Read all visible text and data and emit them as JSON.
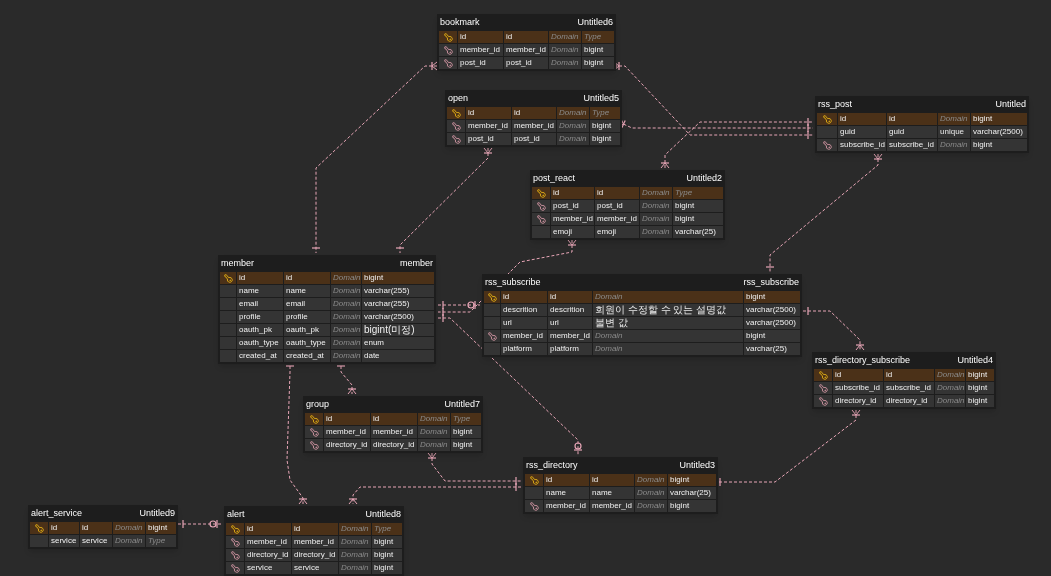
{
  "tables": [
    {
      "name": "bookmark",
      "label": "Untitled6",
      "columns": [
        {
          "kind": "pk",
          "logical": "id",
          "physical": "id",
          "domain": "Domain",
          "domain_placeholder": true,
          "type": "Type",
          "type_placeholder": true
        },
        {
          "kind": "fk",
          "logical": "member_id",
          "physical": "member_id",
          "domain": "Domain",
          "domain_placeholder": true,
          "type": "bigint",
          "type_placeholder": false
        },
        {
          "kind": "fk",
          "logical": "post_id",
          "physical": "post_id",
          "domain": "Domain",
          "domain_placeholder": true,
          "type": "bigint",
          "type_placeholder": false
        }
      ]
    },
    {
      "name": "open",
      "label": "Untitled5",
      "columns": [
        {
          "kind": "pk",
          "logical": "id",
          "physical": "id",
          "domain": "Domain",
          "domain_placeholder": true,
          "type": "Type",
          "type_placeholder": true
        },
        {
          "kind": "fk",
          "logical": "member_id",
          "physical": "member_id",
          "domain": "Domain",
          "domain_placeholder": true,
          "type": "bigint",
          "type_placeholder": false
        },
        {
          "kind": "fk",
          "logical": "post_id",
          "physical": "post_id",
          "domain": "Domain",
          "domain_placeholder": true,
          "type": "bigint",
          "type_placeholder": false
        }
      ]
    },
    {
      "name": "rss_post",
      "label": "Untitled",
      "columns": [
        {
          "kind": "pk",
          "logical": "id",
          "physical": "id",
          "domain": "Domain",
          "domain_placeholder": true,
          "type": "bigint",
          "type_placeholder": false
        },
        {
          "kind": "none",
          "logical": "guid",
          "physical": "guid",
          "domain": "unique",
          "domain_placeholder": false,
          "type": "varchar(2500)",
          "type_placeholder": false
        },
        {
          "kind": "fk",
          "logical": "subscribe_id",
          "physical": "subscribe_id",
          "domain": "Domain",
          "domain_placeholder": true,
          "type": "bigint",
          "type_placeholder": false
        }
      ]
    },
    {
      "name": "post_react",
      "label": "Untitled2",
      "columns": [
        {
          "kind": "pk",
          "logical": "id",
          "physical": "id",
          "domain": "Domain",
          "domain_placeholder": true,
          "type": "Type",
          "type_placeholder": true
        },
        {
          "kind": "fk",
          "logical": "post_id",
          "physical": "post_id",
          "domain": "Domain",
          "domain_placeholder": true,
          "type": "bigint",
          "type_placeholder": false
        },
        {
          "kind": "fk",
          "logical": "member_id",
          "physical": "member_id",
          "domain": "Domain",
          "domain_placeholder": true,
          "type": "bigint",
          "type_placeholder": false
        },
        {
          "kind": "none",
          "logical": "emoji",
          "physical": "emoji",
          "domain": "Domain",
          "domain_placeholder": true,
          "type": "varchar(25)",
          "type_placeholder": false
        }
      ]
    },
    {
      "name": "member",
      "label": "member",
      "columns": [
        {
          "kind": "pk",
          "logical": "id",
          "physical": "id",
          "domain": "Domain",
          "domain_placeholder": true,
          "type": "bigint",
          "type_placeholder": false
        },
        {
          "kind": "none",
          "logical": "name",
          "physical": "name",
          "domain": "Domain",
          "domain_placeholder": true,
          "type": "varchar(255)",
          "type_placeholder": false
        },
        {
          "kind": "none",
          "logical": "email",
          "physical": "email",
          "domain": "Domain",
          "domain_placeholder": true,
          "type": "varchar(255)",
          "type_placeholder": false
        },
        {
          "kind": "none",
          "logical": "profile",
          "physical": "profile",
          "domain": "Domain",
          "domain_placeholder": true,
          "type": "varchar(2500)",
          "type_placeholder": false
        },
        {
          "kind": "none",
          "logical": "oauth_pk",
          "physical": "oauth_pk",
          "domain": "Domain",
          "domain_placeholder": true,
          "type": "bigint(미정)",
          "type_placeholder": false
        },
        {
          "kind": "none",
          "logical": "oauth_type",
          "physical": "oauth_type",
          "domain": "Domain",
          "domain_placeholder": true,
          "type": "enum",
          "type_placeholder": false
        },
        {
          "kind": "none",
          "logical": "created_at",
          "physical": "created_at",
          "domain": "Domain",
          "domain_placeholder": true,
          "type": "date",
          "type_placeholder": false
        }
      ]
    },
    {
      "name": "rss_subscribe",
      "label": "rss_subscribe",
      "columns": [
        {
          "kind": "pk",
          "logical": "id",
          "physical": "id",
          "domain": "Domain",
          "domain_placeholder": true,
          "type": "bigint",
          "type_placeholder": false
        },
        {
          "kind": "none",
          "logical": "descrition",
          "physical": "descrition",
          "domain": "회원이 수정할 수 있는 설명값",
          "domain_placeholder": false,
          "type": "varchar(2500)",
          "type_placeholder": false
        },
        {
          "kind": "none",
          "logical": "url",
          "physical": "url",
          "domain": "불변 값",
          "domain_placeholder": false,
          "type": "varchar(2500)",
          "type_placeholder": false
        },
        {
          "kind": "fk",
          "logical": "member_id",
          "physical": "member_id",
          "domain": "Domain",
          "domain_placeholder": true,
          "type": "bigint",
          "type_placeholder": false
        },
        {
          "kind": "none",
          "logical": "platform",
          "physical": "platform",
          "domain": "Domain",
          "domain_placeholder": true,
          "type": "varchar(25)",
          "type_placeholder": false
        }
      ]
    },
    {
      "name": "rss_directory_subscribe",
      "label": "Untitled4",
      "columns": [
        {
          "kind": "pk",
          "logical": "id",
          "physical": "id",
          "domain": "Domain",
          "domain_placeholder": true,
          "type": "bigint",
          "type_placeholder": false
        },
        {
          "kind": "fk",
          "logical": "subscribe_id",
          "physical": "subscribe_id",
          "domain": "Domain",
          "domain_placeholder": true,
          "type": "bigint",
          "type_placeholder": false
        },
        {
          "kind": "fk",
          "logical": "directory_id",
          "physical": "directory_id",
          "domain": "Domain",
          "domain_placeholder": true,
          "type": "bigint",
          "type_placeholder": false
        }
      ]
    },
    {
      "name": "group",
      "label": "Untitled7",
      "columns": [
        {
          "kind": "pk",
          "logical": "id",
          "physical": "id",
          "domain": "Domain",
          "domain_placeholder": true,
          "type": "Type",
          "type_placeholder": true
        },
        {
          "kind": "fk",
          "logical": "member_id",
          "physical": "member_id",
          "domain": "Domain",
          "domain_placeholder": true,
          "type": "bigint",
          "type_placeholder": false
        },
        {
          "kind": "fk",
          "logical": "directory_id",
          "physical": "directory_id",
          "domain": "Domain",
          "domain_placeholder": true,
          "type": "bigint",
          "type_placeholder": false
        }
      ]
    },
    {
      "name": "rss_directory",
      "label": "Untitled3",
      "columns": [
        {
          "kind": "pk",
          "logical": "id",
          "physical": "id",
          "domain": "Domain",
          "domain_placeholder": true,
          "type": "bigint",
          "type_placeholder": false
        },
        {
          "kind": "none",
          "logical": "name",
          "physical": "name",
          "domain": "Domain",
          "domain_placeholder": true,
          "type": "varchar(25)",
          "type_placeholder": false
        },
        {
          "kind": "fk",
          "logical": "member_id",
          "physical": "member_id",
          "domain": "Domain",
          "domain_placeholder": true,
          "type": "bigint",
          "type_placeholder": false
        }
      ]
    },
    {
      "name": "alert_service",
      "label": "Untitled9",
      "columns": [
        {
          "kind": "pk",
          "logical": "id",
          "physical": "id",
          "domain": "Domain",
          "domain_placeholder": true,
          "type": "bigint",
          "type_placeholder": false
        },
        {
          "kind": "none",
          "logical": "service",
          "physical": "service",
          "domain": "Domain",
          "domain_placeholder": true,
          "type": "Type",
          "type_placeholder": true
        }
      ]
    },
    {
      "name": "alert",
      "label": "Untitled8",
      "columns": [
        {
          "kind": "pk",
          "logical": "id",
          "physical": "id",
          "domain": "Domain",
          "domain_placeholder": true,
          "type": "Type",
          "type_placeholder": true
        },
        {
          "kind": "fk",
          "logical": "member_id",
          "physical": "member_id",
          "domain": "Domain",
          "domain_placeholder": true,
          "type": "bigint",
          "type_placeholder": false
        },
        {
          "kind": "fk",
          "logical": "directory_id",
          "physical": "directory_id",
          "domain": "Domain",
          "domain_placeholder": true,
          "type": "bigint",
          "type_placeholder": false
        },
        {
          "kind": "fk",
          "logical": "service",
          "physical": "service",
          "domain": "Domain",
          "domain_placeholder": true,
          "type": "bigint",
          "type_placeholder": false
        }
      ]
    }
  ]
}
